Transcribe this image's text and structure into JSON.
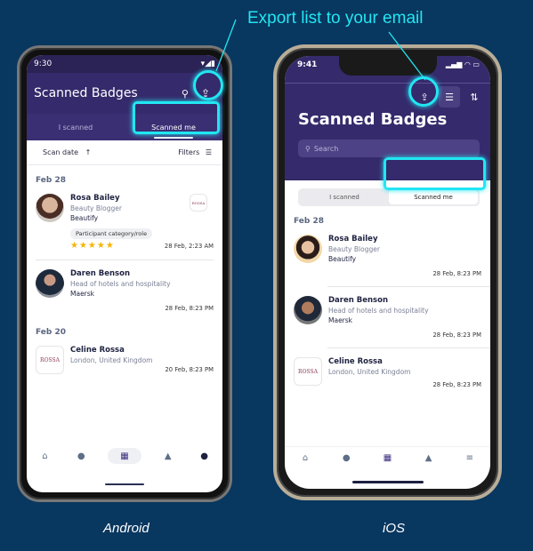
{
  "annotation": {
    "callout": "Export list to your email",
    "accent": "#22e6f2"
  },
  "captions": {
    "android": "Android",
    "ios": "iOS"
  },
  "android": {
    "status_time": "9:30",
    "title": "Scanned Badges",
    "tabs": [
      {
        "label": "I scanned",
        "active": false
      },
      {
        "label": "Scanned me",
        "active": true
      }
    ],
    "sort_label": "Scan date",
    "sort_arrow": "↑",
    "filters_label": "Filters",
    "groups": [
      {
        "date": "Feb 28",
        "items": [
          {
            "name": "Rosa Bailey",
            "role": "Beauty Blogger",
            "company": "Beautify",
            "chip": "Participant category/role",
            "stars": "★★★★★",
            "rating": 5,
            "time": "28 Feb, 2:23 AM"
          },
          {
            "name": "Daren Benson",
            "role": "Head of hotels and hospitality",
            "company": "Maersk",
            "time": "28 Feb, 8:23 PM"
          }
        ]
      },
      {
        "date": "Feb 20",
        "items": [
          {
            "name": "Celine Rossa",
            "role": "London, United Kingdom",
            "time": "20 Feb, 8:23 PM",
            "logo_text": "ROSSA"
          }
        ]
      }
    ],
    "nav": [
      "home",
      "chat",
      "qr-code",
      "bell",
      "profile"
    ]
  },
  "ios": {
    "status_time": "9:41",
    "title": "Scanned Badges",
    "search_placeholder": "Search",
    "tabs": [
      {
        "label": "I scanned",
        "active": false
      },
      {
        "label": "Scanned me",
        "active": true
      }
    ],
    "groups": [
      {
        "date": "Feb 28",
        "items": [
          {
            "name": "Rosa Bailey",
            "role": "Beauty Blogger",
            "company": "Beautify",
            "time": "28 Feb, 8:23 PM"
          },
          {
            "name": "Daren Benson",
            "role": "Head of hotels and hospitality",
            "company": "Maersk",
            "time": "28 Feb, 8:23 PM"
          },
          {
            "name": "Celine Rossa",
            "role": "London, United Kingdom",
            "time": "28 Feb, 8:23 PM",
            "logo_text": "ROSSA"
          }
        ]
      }
    ],
    "nav": [
      "home",
      "chat",
      "qr-code",
      "bell",
      "menu"
    ]
  }
}
